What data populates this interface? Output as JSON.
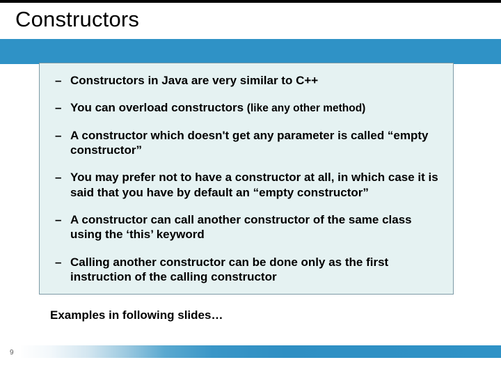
{
  "title": "Constructors",
  "bullets": [
    {
      "text": "Constructors in Java are very similar to C++",
      "note": ""
    },
    {
      "text": "You can overload constructors ",
      "note": "(like any other method)"
    },
    {
      "text": "A constructor which doesn't get any parameter is called “empty constructor”",
      "note": ""
    },
    {
      "text": "You may prefer not to have a constructor at all, in which case it is said that you have by default an “empty constructor”",
      "note": ""
    },
    {
      "text": "A constructor can call another constructor of the same class using the ‘this’ keyword",
      "note": ""
    },
    {
      "text": "Calling another constructor can be done only as the first instruction of the calling constructor",
      "note": ""
    }
  ],
  "outside_text": "Examples in following slides…",
  "page_number": "9"
}
